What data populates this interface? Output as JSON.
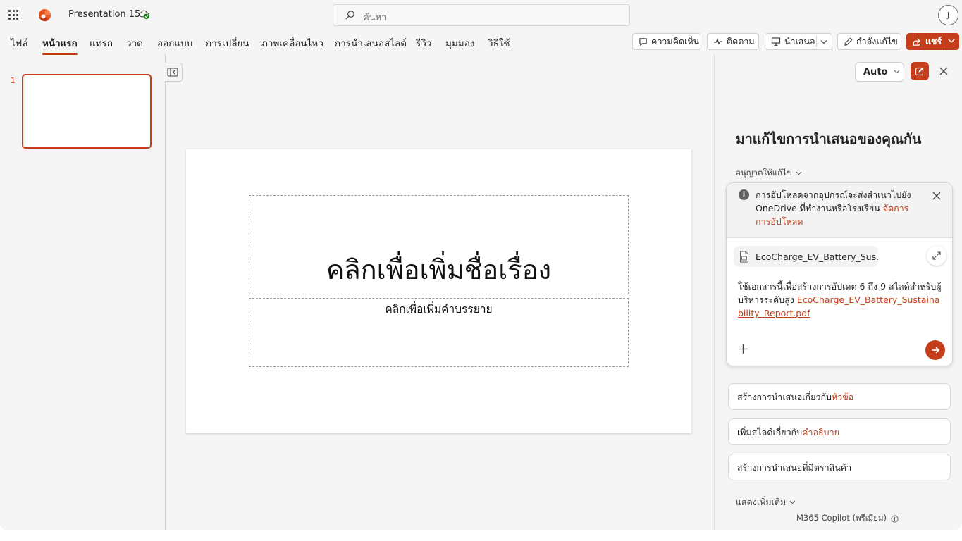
{
  "app": {
    "doc_title": "Presentation 15",
    "search_placeholder": "ค้นหา",
    "avatar_initial": "J"
  },
  "ribbon": {
    "tabs": [
      "ไฟล์",
      "หน้าแรก",
      "แทรก",
      "วาด",
      "ออกแบบ",
      "การเปลี่ยน",
      "ภาพเคลื่อนไหว",
      "การนำเสนอสไลด์",
      "รีวิว",
      "มุมมอง",
      "วิธีใช้"
    ],
    "active_tab": "หน้าแรก",
    "comments_label": "ความคิดเห็น",
    "catchup_label": "ติดตาม",
    "present_label": "นำเสนอ",
    "editing_label": "กำลังแก้ไข",
    "share_label": "แชร์",
    "accent_color": "#c43e1c"
  },
  "thumbnails": {
    "slide_number": "1"
  },
  "slide": {
    "title_placeholder": "คลิกเพื่อเพิ่มชื่อเรื่อง",
    "subtitle_placeholder": "คลิกเพื่อเพิ่มคำบรรยาย"
  },
  "copilot": {
    "mode_label": "Auto",
    "heading": "มาแก้ไขการนำเสนอของคุณกัน",
    "permission_label": "อนุญาตให้แก้ไข",
    "notice_text": "การอัปโหลดจากอุปกรณ์จะส่งสำเนาไปยัง OneDrive ที่ทำงานหรือโรงเรียน",
    "notice_link": "จัดการการอัปโหลด",
    "file_chip": "EcoCharge_EV_Battery_Sus...",
    "prompt_text": "ใช้เอกสารนี้เพื่อสร้างการอัปเดต 6 ถึง 9 สไลด์สำหรับผู้บริหารระดับสูง",
    "prompt_reference": "EcoCharge_EV_Battery_Sustainability_Report.pdf",
    "suggestions": [
      {
        "text": "สร้างการนำเสนอเกี่ยวกับ",
        "highlight": "หัวข้อ"
      },
      {
        "text": "เพิ่มสไลด์เกี่ยวกับ",
        "highlight": "คำอธิบาย"
      },
      {
        "text": "สร้างการนำเสนอที่มีตราสินค้า",
        "highlight": ""
      }
    ],
    "show_more": "แสดงเพิ่มเติม",
    "footer": "M365 Copilot (พรีเมียม)"
  }
}
